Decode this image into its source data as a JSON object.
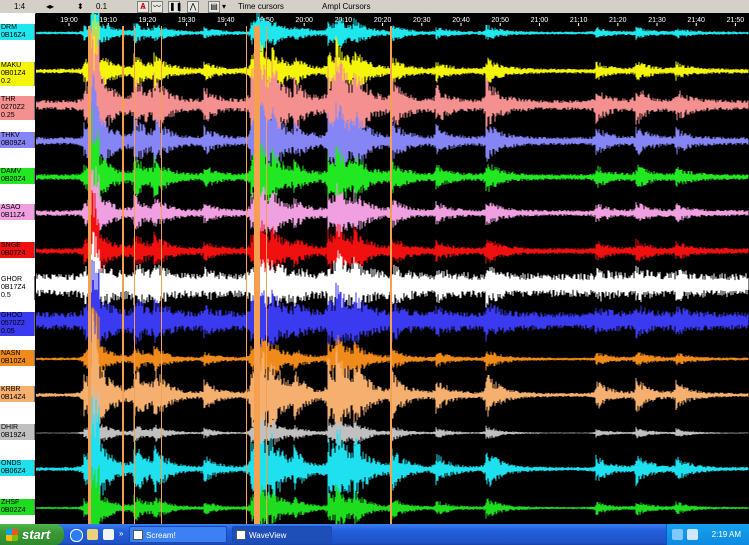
{
  "toolbar": {
    "zoom_ratio": "1:4",
    "step": "0.1",
    "time_cursors": "Time cursors",
    "ampl_cursors": "Ampl Cursors"
  },
  "time_axis": {
    "ticks": [
      "19:00",
      "19:10",
      "19:20",
      "19:30",
      "19:40",
      "19:50",
      "20:00",
      "20:10",
      "20:20",
      "20:30",
      "20:40",
      "20:50",
      "21:00",
      "21:10",
      "21:20",
      "21:30",
      "21:40",
      "21:50"
    ]
  },
  "channels": [
    {
      "name": "DRM",
      "code": "0B16Z4",
      "scale": "",
      "color": "#1ee8ee"
    },
    {
      "name": "MAKU",
      "code": "0B01Z4",
      "scale": "0.2",
      "color": "#f5f50a"
    },
    {
      "name": "THR",
      "code": "0270Z2",
      "scale": "0.25",
      "color": "#f59090"
    },
    {
      "name": "THKV",
      "code": "0B09Z4",
      "scale": "",
      "color": "#8585f5"
    },
    {
      "name": "DAMV",
      "code": "0B20Z4",
      "scale": "",
      "color": "#22e822"
    },
    {
      "name": "ASAO",
      "code": "0B11Z4",
      "scale": "",
      "color": "#f0a0e0"
    },
    {
      "name": "SNGE",
      "code": "0B07Z4",
      "scale": "",
      "color": "#f01010"
    },
    {
      "name": "GHOR",
      "code": "0B17Z4",
      "scale": "0.5",
      "color": "#ffffff"
    },
    {
      "name": "GHOO",
      "code": "0570Z2",
      "scale": "0.05",
      "color": "#3a3af0"
    },
    {
      "name": "NASN",
      "code": "0B10Z4",
      "scale": "",
      "color": "#f08a1a"
    },
    {
      "name": "KRBR",
      "code": "0B14Z4",
      "scale": "",
      "color": "#f5b070"
    },
    {
      "name": "DHIR",
      "code": "0B19Z4",
      "scale": "",
      "color": "#c0c0c0"
    },
    {
      "name": "ONDS",
      "code": "0B06Z4",
      "scale": "",
      "color": "#1ee0ee"
    },
    {
      "name": "ZHSF",
      "code": "0B02Z4",
      "scale": "",
      "color": "#1edc1e"
    }
  ],
  "taskbar": {
    "start_label": "start",
    "tasks": [
      "Scream!",
      "WaveView"
    ],
    "clock": "2:19 AM"
  },
  "colors": {
    "cursor_line": "#f5a050",
    "taskbar": "#245edc"
  }
}
